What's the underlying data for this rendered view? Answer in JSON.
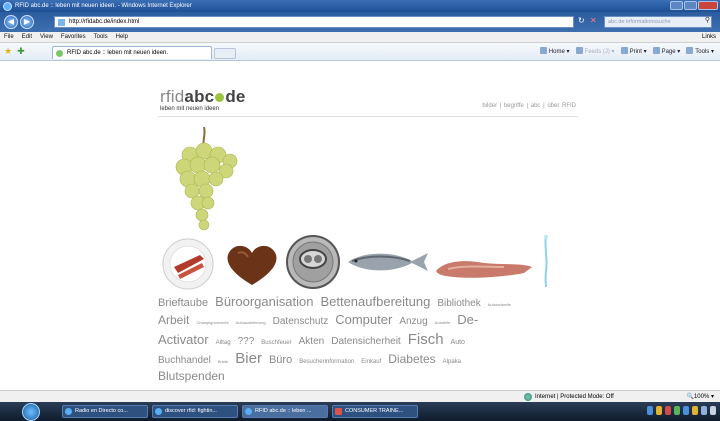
{
  "window": {
    "title": "RFID abc.de :: leben mit neuen ideen. - Windows Internet Explorer"
  },
  "address_bar": {
    "url": "http://rfidabc.de/index.html",
    "search_placeholder": "abc.de informationssuche"
  },
  "menu": {
    "items": [
      "File",
      "Edit",
      "View",
      "Favorites",
      "Tools",
      "Help"
    ],
    "links_label": "Links"
  },
  "tabs": [
    {
      "label": "RFID abc.de :: leben mit neuen ideen."
    }
  ],
  "command_bar": {
    "home": "Home",
    "feeds": "Feeds (J)",
    "print": "Print",
    "page": "Page",
    "tools": "Tools"
  },
  "site": {
    "logo_prefix": "rfid",
    "logo_abc": "abc",
    "logo_de": "de",
    "tagline": "leben mit neuen ideen",
    "nav": "bilder | begriffe | abc | über RFID",
    "accent": "#9ac43b"
  },
  "tag_cloud": [
    [
      {
        "text": "Brieftaube",
        "size": 11
      },
      {
        "text": "Büroorganisation",
        "size": 13
      },
      {
        "text": "Bettenaufbereitung",
        "size": 13
      },
      {
        "text": "Bibliothek",
        "size": 10
      },
      {
        "text": "Autoradwelle",
        "size": 4
      }
    ],
    [
      {
        "text": "Arbeit",
        "size": 12
      },
      {
        "text": "Champignonzucht",
        "size": 4
      },
      {
        "text": "Autoauslieferung",
        "size": 4
      },
      {
        "text": "Datenschutz",
        "size": 10
      },
      {
        "text": "Computer",
        "size": 13
      },
      {
        "text": "Anzug",
        "size": 10
      },
      {
        "text": "Autoteile",
        "size": 4
      },
      {
        "text": "De-",
        "size": 13
      }
    ],
    [
      {
        "text": "Activator",
        "size": 13
      },
      {
        "text": "Alltag",
        "size": 6
      },
      {
        "text": "???",
        "size": 10
      },
      {
        "text": "Buschfeuer",
        "size": 6
      },
      {
        "text": "Akten",
        "size": 10
      },
      {
        "text": "Datensicherheit",
        "size": 10
      },
      {
        "text": "Fisch",
        "size": 15
      },
      {
        "text": "Auto",
        "size": 7
      }
    ],
    [
      {
        "text": "Buchhandel",
        "size": 10
      },
      {
        "text": "Briefe",
        "size": 4
      },
      {
        "text": "Bier",
        "size": 15
      },
      {
        "text": "Büro",
        "size": 11
      },
      {
        "text": "Besucherinformation",
        "size": 6
      },
      {
        "text": "Einkauf",
        "size": 6
      },
      {
        "text": "Diabetes",
        "size": 12
      },
      {
        "text": "Alpaka",
        "size": 6
      }
    ],
    [
      {
        "text": "Blutspenden",
        "size": 12
      }
    ]
  ],
  "status_bar": {
    "zone": "Internet | Protected Mode: Off",
    "zoom": "100%"
  },
  "taskbar": {
    "items": [
      {
        "label": "Radio en Directo co..."
      },
      {
        "label": "discover rfid: fightin..."
      },
      {
        "label": "RFID abc.de :: leben ..."
      },
      {
        "label": "CONSUMER TRAINE..."
      }
    ]
  }
}
